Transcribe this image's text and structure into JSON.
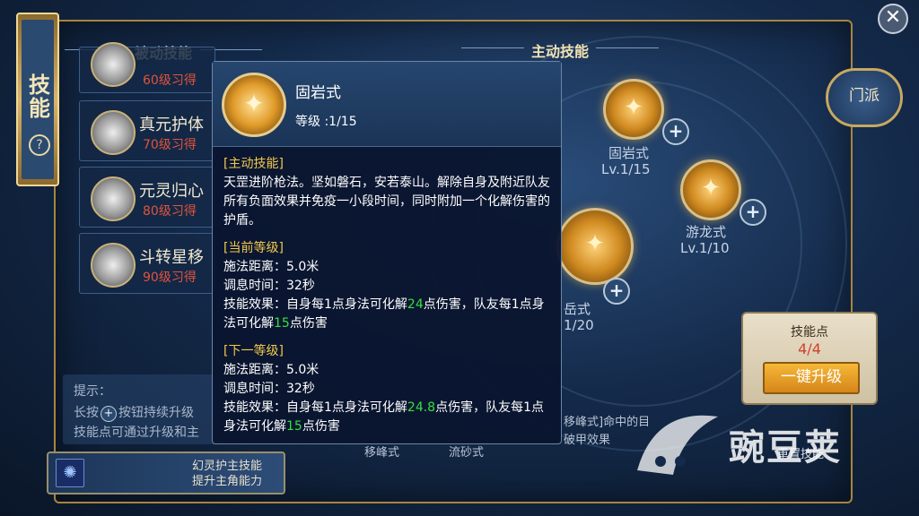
{
  "side_tab": {
    "title": "技能",
    "help_glyph": "?"
  },
  "passive": {
    "title": "被动技能",
    "items": [
      {
        "name": "",
        "requirement": "60级习得"
      },
      {
        "name": "真元护体",
        "requirement": "70级习得"
      },
      {
        "name": "元灵归心",
        "requirement": "80级习得"
      },
      {
        "name": "斗转星移",
        "requirement": "90级习得"
      }
    ]
  },
  "active": {
    "title": "主动技能",
    "skills": [
      {
        "name": "固岩式",
        "level": "Lv.1/15"
      },
      {
        "name": "游龙式",
        "level": "Lv.1/10"
      },
      {
        "name": "岳式",
        "level": "1/20"
      }
    ],
    "bottom_labels": [
      "移峰式",
      "流砂式"
    ],
    "partial_texts": [
      "移峰式]命中的目",
      "破甲效果"
    ]
  },
  "tooltip": {
    "title": "固岩式",
    "level_label": "等级 :1/15",
    "active_head": "[主动技能]",
    "description": "天罡进阶枪法。坚如磐石，安若泰山。解除自身及附近队友所有负面效果并免疫一小段时间，同时附加一个化解伤害的护盾。",
    "current_head": "[当前等级]",
    "current_range": "施法距离：5.0米",
    "current_cooldown": "调息时间：32秒",
    "current_effect_pre": "技能效果：自身每1点身法可化解",
    "current_effect_v1": "24",
    "current_effect_mid": "点伤害，队友每1点身法可化解",
    "current_effect_v2": "15",
    "current_effect_post": "点伤害",
    "next_head": "[下一等级]",
    "next_range": "施法距离：5.0米",
    "next_cooldown": "调息时间：32秒",
    "next_effect_pre": "技能效果：自身每1点身法可化解",
    "next_effect_v1": "24.8",
    "next_effect_mid": "点伤害，队友每1点身法可化解",
    "next_effect_v2": "15",
    "next_effect_post": "点伤害"
  },
  "hint": {
    "title": "提示：",
    "line1_pre": "长按",
    "line1_post": "按钮持续升级",
    "line2": "技能点可通过升级和主"
  },
  "banner": {
    "line1": "幻灵护主技能",
    "line2": "提升主角能力"
  },
  "sect_label": "门派",
  "close_glyph": "✕",
  "points": {
    "title": "技能点",
    "value": "4/4",
    "upgrade_label": "一键升级"
  },
  "reset_label": "重置技能",
  "watermark": "豌豆荚",
  "icons": {
    "plus": "+",
    "skill_glyph": "✦",
    "banner_glyph": "✺"
  }
}
